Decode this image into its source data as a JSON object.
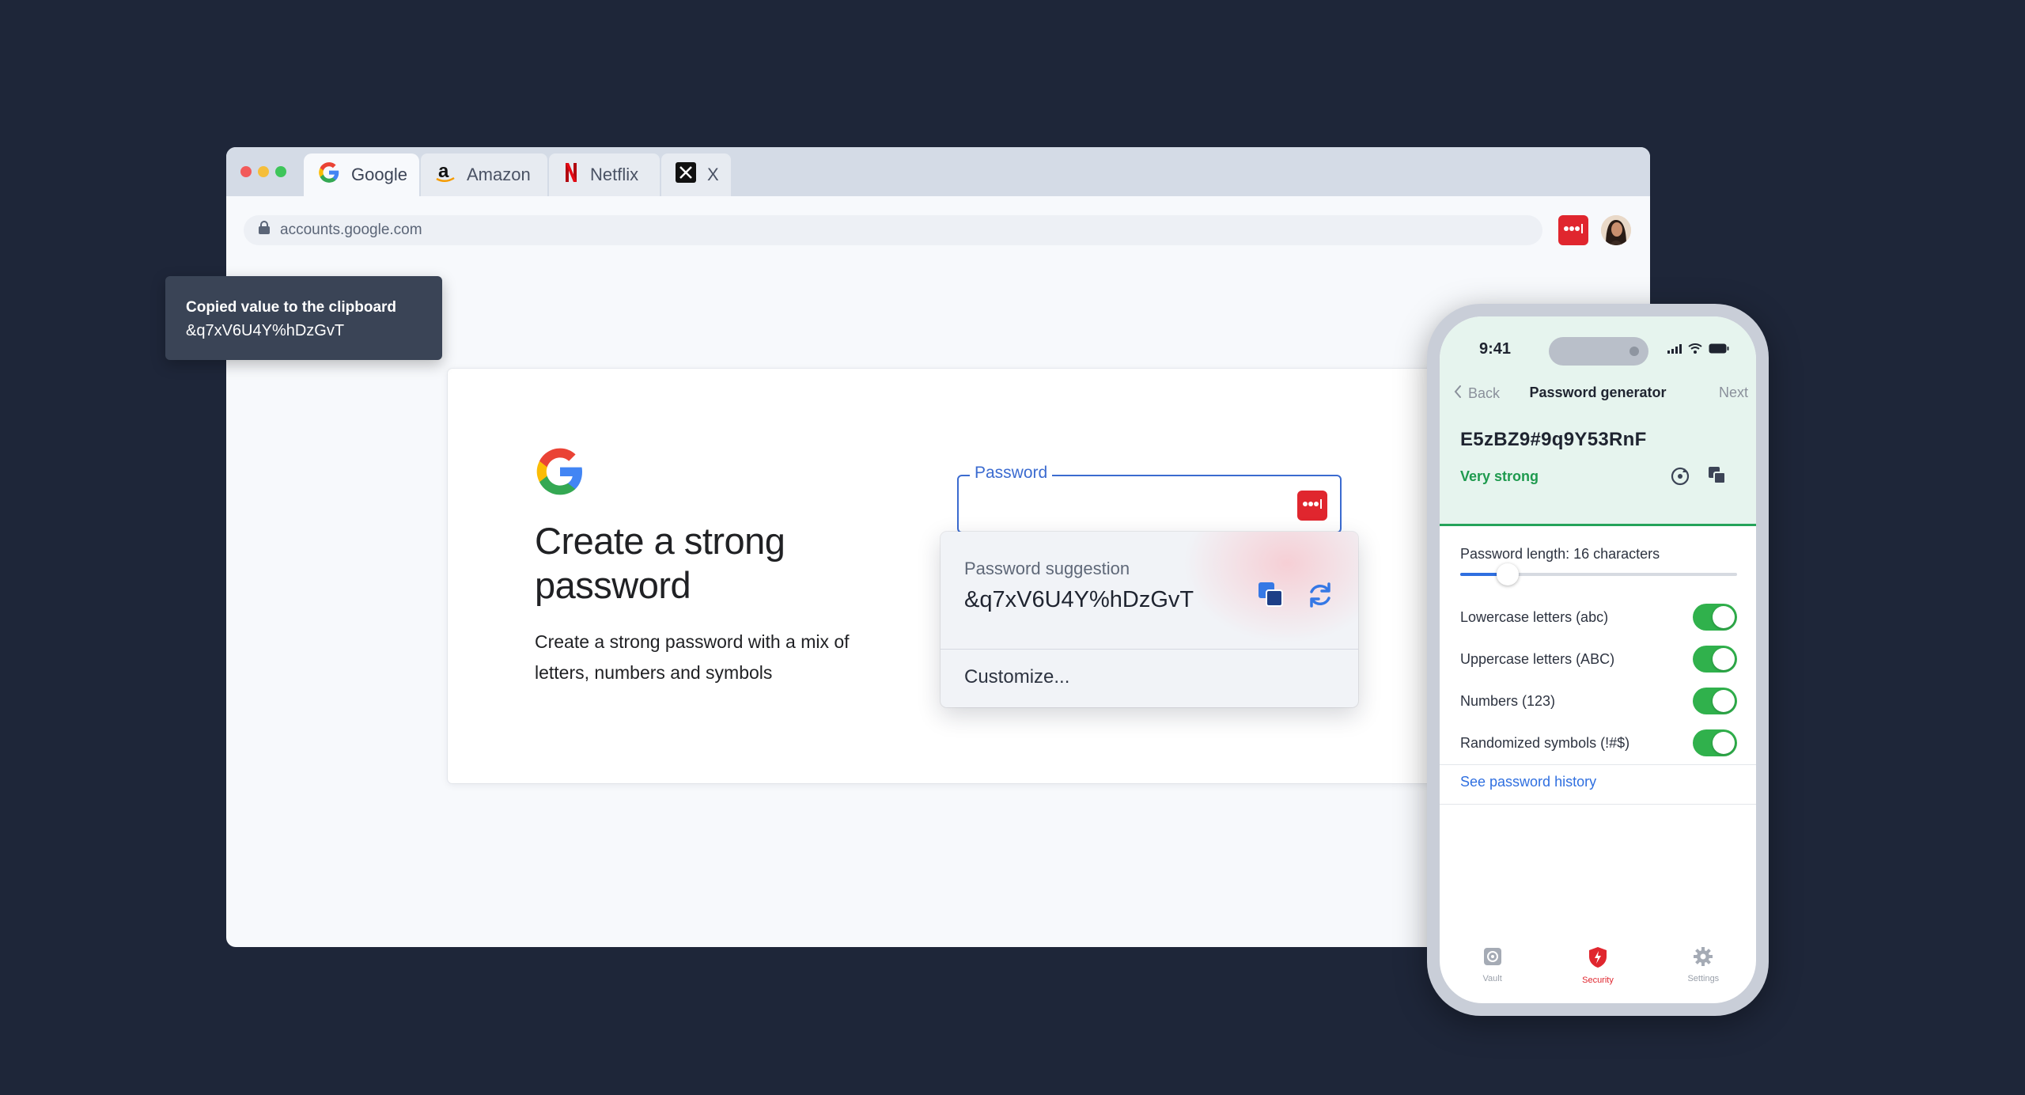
{
  "browser": {
    "tabs": [
      {
        "label": "Google",
        "icon": "google-icon",
        "active": true
      },
      {
        "label": "Amazon",
        "icon": "amazon-icon",
        "active": false
      },
      {
        "label": "Netflix",
        "icon": "netflix-icon",
        "active": false
      },
      {
        "label": "X",
        "icon": "x-icon",
        "active": false
      }
    ],
    "url": "accounts.google.com",
    "extension_icon": "password-manager-icon",
    "colors": {
      "accent_red": "#e0262e",
      "accent_blue": "#3b6bd0"
    }
  },
  "toast": {
    "title": "Copied value to the clipboard",
    "value": "&q7xV6U4Y%hDzGvT"
  },
  "card": {
    "title": "Create a strong password",
    "description": "Create a strong password with a mix of letters, numbers and symbols",
    "password_field": {
      "label": "Password",
      "value": ""
    }
  },
  "suggestion": {
    "label": "Password suggestion",
    "value": "&q7xV6U4Y%hDzGvT",
    "customize_label": "Customize..."
  },
  "phone": {
    "time": "9:41",
    "nav": {
      "back_label": "Back",
      "title": "Password generator",
      "next_label": "Next"
    },
    "generated_password": "E5zBZ9#9q9Y53RnF",
    "strength": "Very strong",
    "length_label": "Password length: 16 characters",
    "length_value": 16,
    "length_fraction": 0.17,
    "options": [
      {
        "label": "Lowercase letters (abc)",
        "enabled": true
      },
      {
        "label": "Uppercase letters (ABC)",
        "enabled": true
      },
      {
        "label": "Numbers (123)",
        "enabled": true
      },
      {
        "label": "Randomized symbols (!#$)",
        "enabled": true
      }
    ],
    "history_link": "See password history",
    "tabs": [
      {
        "label": "Vault",
        "icon": "vault-icon",
        "active": false
      },
      {
        "label": "Security",
        "icon": "security-shield-icon",
        "active": true
      },
      {
        "label": "Settings",
        "icon": "gear-icon",
        "active": false
      }
    ],
    "colors": {
      "strength_green": "#1e9a4e",
      "toggle_green": "#30b14c",
      "link_blue": "#2f6fe0"
    }
  }
}
